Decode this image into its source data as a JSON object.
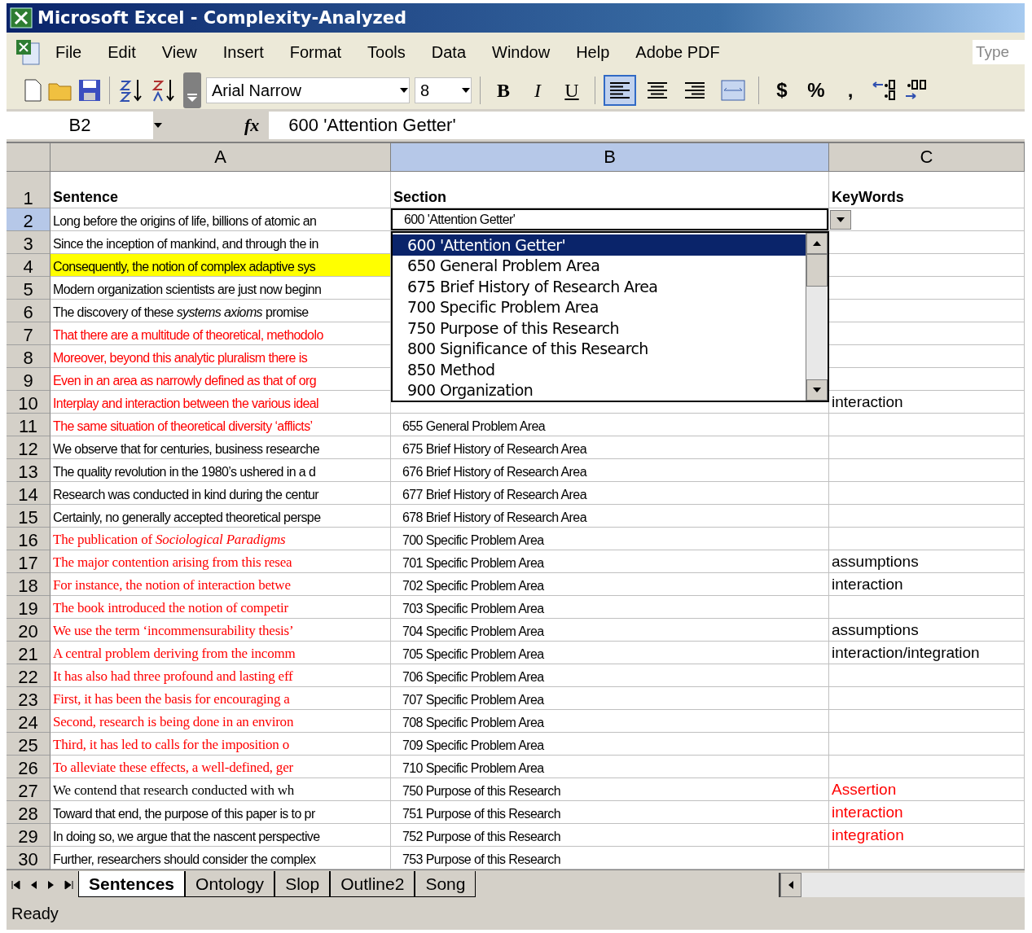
{
  "window": {
    "title": "Microsoft Excel - Complexity-Analyzed"
  },
  "menu": [
    "File",
    "Edit",
    "View",
    "Insert",
    "Format",
    "Tools",
    "Data",
    "Window",
    "Help",
    "Adobe PDF"
  ],
  "help_search": {
    "placeholder": "Type"
  },
  "toolbar": {
    "font": "Arial Narrow",
    "size": "8",
    "format_buttons": [
      "B",
      "I",
      "U"
    ],
    "number_buttons": [
      "$",
      "%",
      ","
    ],
    "alignment": [
      {
        "kind": "left",
        "selected": true
      },
      {
        "kind": "center",
        "selected": false
      },
      {
        "kind": "right",
        "selected": false
      },
      {
        "kind": "merge",
        "selected": false
      }
    ]
  },
  "formula_bar": {
    "name_box": "B2",
    "function_label": "fx",
    "formula": "600 'Attention Getter'"
  },
  "columns": [
    {
      "label": "A",
      "selected": false
    },
    {
      "label": "B",
      "selected": true
    },
    {
      "label": "C",
      "selected": false
    }
  ],
  "rows": [
    {
      "number": "1",
      "selected": false,
      "sentence": {
        "text": "Sentence",
        "kind": "header"
      },
      "section": {
        "text": "Section",
        "kind": "header"
      },
      "keywords": {
        "text": "KeyWords",
        "kind": "header"
      }
    },
    {
      "number": "2",
      "selected": true,
      "sentence": {
        "text": "Long before the origins of life, billions of atomic an",
        "kind": "sans",
        "color": "#000000"
      }
    },
    {
      "number": "3",
      "selected": false,
      "sentence": {
        "text": "Since the inception of mankind, and through the in",
        "kind": "sans",
        "color": "#000000"
      }
    },
    {
      "number": "4",
      "selected": false,
      "sentence": {
        "text": "Consequently, the notion of complex adaptive sys",
        "kind": "sans",
        "color": "#000000",
        "highlighted": true
      }
    },
    {
      "number": "5",
      "selected": false,
      "sentence": {
        "text": "Modern organization scientists are just now beginn",
        "kind": "sans",
        "color": "#000000"
      }
    },
    {
      "number": "6",
      "selected": false,
      "sentence": {
        "text": "The discovery of these *systems axioms* promise",
        "kind": "sans",
        "color": "#000000"
      }
    },
    {
      "number": "7",
      "selected": false,
      "sentence": {
        "text": "That there are a multitude of theoretical, methodolo",
        "kind": "sans",
        "color": "#ff0000"
      }
    },
    {
      "number": "8",
      "selected": false,
      "sentence": {
        "text": "Moreover, beyond this analytic pluralism there is",
        "kind": "sans",
        "color": "#ff0000"
      }
    },
    {
      "number": "9",
      "selected": false,
      "sentence": {
        "text": "Even in an area as narrowly defined as that of org",
        "kind": "sans",
        "color": "#ff0000"
      }
    },
    {
      "number": "10",
      "selected": false,
      "sentence": {
        "text": "Interplay and interaction between the various ideal",
        "kind": "sans",
        "color": "#ff0000"
      },
      "keywords": {
        "text": "interaction",
        "color": "#000000"
      }
    },
    {
      "number": "11",
      "selected": false,
      "sentence": {
        "text": "The same situation of theoretical diversity ‘afflicts’",
        "kind": "sans",
        "color": "#ff0000"
      },
      "section": {
        "text": "655 General Problem Area"
      }
    },
    {
      "number": "12",
      "selected": false,
      "sentence": {
        "text": "We observe that for centuries, business researche",
        "kind": "sans",
        "color": "#000000"
      },
      "section": {
        "text": "675 Brief History of Research Area"
      }
    },
    {
      "number": "13",
      "selected": false,
      "sentence": {
        "text": "The quality revolution in the 1980’s ushered in a d",
        "kind": "sans",
        "color": "#000000"
      },
      "section": {
        "text": "676 Brief History of Research Area"
      }
    },
    {
      "number": "14",
      "selected": false,
      "sentence": {
        "text": "Research was conducted in kind during the centur",
        "kind": "sans",
        "color": "#000000"
      },
      "section": {
        "text": "677 Brief History of Research Area"
      }
    },
    {
      "number": "15",
      "selected": false,
      "sentence": {
        "text": "Certainly, no generally accepted theoretical perspe",
        "kind": "sans",
        "color": "#000000"
      },
      "section": {
        "text": "678 Brief History of Research Area"
      }
    },
    {
      "number": "16",
      "selected": false,
      "sentence": {
        "text": "The publication of *Sociological Paradigms*",
        "kind": "serif",
        "color": "#ff0000"
      },
      "section": {
        "text": "700 Specific Problem Area"
      }
    },
    {
      "number": "17",
      "selected": false,
      "sentence": {
        "text": "The major contention arising from this resea",
        "kind": "serif",
        "color": "#ff0000"
      },
      "section": {
        "text": "701 Specific Problem Area"
      },
      "keywords": {
        "text": "assumptions",
        "color": "#000000"
      }
    },
    {
      "number": "18",
      "selected": false,
      "sentence": {
        "text": "For instance, the notion of interaction betwe",
        "kind": "serif",
        "color": "#ff0000"
      },
      "section": {
        "text": "702 Specific Problem Area"
      },
      "keywords": {
        "text": "interaction",
        "color": "#000000"
      }
    },
    {
      "number": "19",
      "selected": false,
      "sentence": {
        "text": "The book introduced the notion of competir",
        "kind": "serif",
        "color": "#ff0000"
      },
      "section": {
        "text": "703 Specific Problem Area"
      }
    },
    {
      "number": "20",
      "selected": false,
      "sentence": {
        "text": "We use the term ‘incommensurability thesis’",
        "kind": "serif",
        "color": "#ff0000"
      },
      "section": {
        "text": "704 Specific Problem Area"
      },
      "keywords": {
        "text": "assumptions",
        "color": "#000000"
      }
    },
    {
      "number": "21",
      "selected": false,
      "sentence": {
        "text": "A central problem deriving from the incomm",
        "kind": "serif",
        "color": "#ff0000"
      },
      "section": {
        "text": "705 Specific Problem Area"
      },
      "keywords": {
        "text": "interaction/integration",
        "color": "#000000"
      }
    },
    {
      "number": "22",
      "selected": false,
      "sentence": {
        "text": "It has also had three profound and lasting eff",
        "kind": "serif",
        "color": "#ff0000"
      },
      "section": {
        "text": "706 Specific Problem Area"
      }
    },
    {
      "number": "23",
      "selected": false,
      "sentence": {
        "text": "First, it has been the basis for encouraging a",
        "kind": "serif",
        "color": "#ff0000"
      },
      "section": {
        "text": "707 Specific Problem Area"
      }
    },
    {
      "number": "24",
      "selected": false,
      "sentence": {
        "text": "Second, research is being done in an environ",
        "kind": "serif",
        "color": "#ff0000"
      },
      "section": {
        "text": "708 Specific Problem Area"
      }
    },
    {
      "number": "25",
      "selected": false,
      "sentence": {
        "text": "Third, it has led to calls for the imposition o",
        "kind": "serif",
        "color": "#ff0000"
      },
      "section": {
        "text": "709 Specific Problem Area"
      }
    },
    {
      "number": "26",
      "selected": false,
      "sentence": {
        "text": "To alleviate these effects, a well-defined, ger",
        "kind": "serif",
        "color": "#ff0000"
      },
      "section": {
        "text": "710 Specific Problem Area"
      }
    },
    {
      "number": "27",
      "selected": false,
      "sentence": {
        "text": "We contend that research conducted with wh",
        "kind": "serif",
        "color": "#000000"
      },
      "section": {
        "text": "750 Purpose of this Research"
      },
      "keywords": {
        "text": "Assertion",
        "color": "#ff0000"
      }
    },
    {
      "number": "28",
      "selected": false,
      "sentence": {
        "text": "Toward that end, the purpose of this paper is to pr",
        "kind": "sans",
        "color": "#000000"
      },
      "section": {
        "text": "751 Purpose of this Research"
      },
      "keywords": {
        "text": "interaction",
        "color": "#ff0000"
      }
    },
    {
      "number": "29",
      "selected": false,
      "sentence": {
        "text": "In doing so, we argue that the nascent perspective",
        "kind": "sans",
        "color": "#000000"
      },
      "section": {
        "text": "752 Purpose of this Research"
      },
      "keywords": {
        "text": "integration",
        "color": "#ff0000"
      }
    },
    {
      "number": "30",
      "selected": false,
      "sentence": {
        "text": "Further, researchers should consider the complex",
        "kind": "sans",
        "color": "#000000"
      },
      "section": {
        "text": "753 Purpose of this Research"
      }
    }
  ],
  "dropdown": {
    "value": "600 'Attention Getter'",
    "options": [
      {
        "label": "600 'Attention Getter'",
        "selected": true
      },
      {
        "label": "650 General Problem Area",
        "selected": false
      },
      {
        "label": "675 Brief History of Research Area",
        "selected": false
      },
      {
        "label": "700 Specific Problem Area",
        "selected": false
      },
      {
        "label": "750 Purpose of this Research",
        "selected": false
      },
      {
        "label": "800 Significance of this Research",
        "selected": false
      },
      {
        "label": "850 Method",
        "selected": false
      },
      {
        "label": "900 Organization",
        "selected": false
      }
    ]
  },
  "sheet_tabs": [
    {
      "label": "Sentences",
      "selected": true
    },
    {
      "label": "Ontology",
      "selected": false
    },
    {
      "label": "Slop",
      "selected": false
    },
    {
      "label": "Outline2",
      "selected": false
    },
    {
      "label": "Song",
      "selected": false
    }
  ],
  "status_bar": {
    "text": "Ready"
  }
}
